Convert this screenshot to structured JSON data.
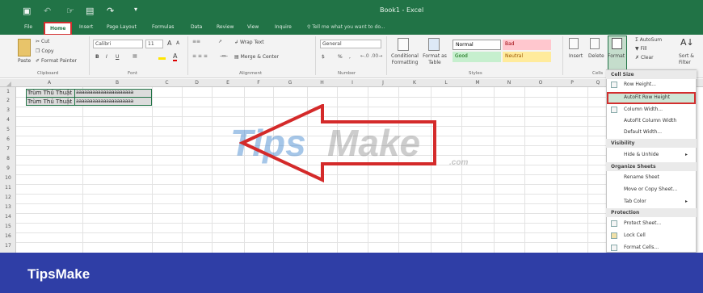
{
  "window": {
    "title": "Book1 - Excel"
  },
  "titlebar_icons": [
    "save-icon",
    "undo-icon",
    "touch-icon",
    "table-icon",
    "redo-icon",
    "customize-icon"
  ],
  "tabs": [
    "File",
    "Home",
    "Insert",
    "Page Layout",
    "Formulas",
    "Data",
    "Review",
    "View",
    "Inquire"
  ],
  "tellme": "Tell me what you want to do...",
  "ribbon": {
    "clipboard": {
      "paste": "Paste",
      "cut": "Cut",
      "copy": "Copy",
      "format_painter": "Format Painter",
      "group": "Clipboard"
    },
    "font": {
      "name": "Calibri",
      "size": "11",
      "bold": "B",
      "italic": "I",
      "underline": "U",
      "grow": "A",
      "shrink": "A",
      "group": "Font"
    },
    "alignment": {
      "wrap": "Wrap Text",
      "merge": "Merge & Center",
      "group": "Alignment"
    },
    "number": {
      "format": "General",
      "currency": "$",
      "percent": "%",
      "comma": ",",
      "group": "Number"
    },
    "styles": {
      "conditional": "Conditional Formatting",
      "format_as_table": "Format as Table",
      "normal": "Normal",
      "bad": "Bad",
      "good": "Good",
      "neutral": "Neutral",
      "group": "Styles"
    },
    "cells": {
      "insert": "Insert",
      "delete": "Delete",
      "format": "Format",
      "group": "Cells"
    },
    "editing": {
      "autosum": "AutoSum",
      "fill": "Fill",
      "clear": "Clear",
      "sort": "Sort & Filter"
    },
    "colors": {
      "bad_bg": "#ffc7ce",
      "good_bg": "#c6efce",
      "neutral_bg": "#ffeb9c",
      "brand_green": "#217346"
    }
  },
  "columns": [
    "A",
    "B",
    "C",
    "D",
    "E",
    "F",
    "G",
    "H",
    "I",
    "J",
    "K",
    "L",
    "M",
    "N",
    "O",
    "P",
    "Q"
  ],
  "rows": [
    "1",
    "2",
    "3",
    "4",
    "5",
    "6",
    "7",
    "8",
    "9",
    "10",
    "11",
    "12",
    "13",
    "14",
    "15",
    "16",
    "17"
  ],
  "cells": {
    "a1": "Trùm Thủ Thuật",
    "b1": "aaaaaaaaaaaaaaaaaaaaa",
    "a2": "Trùm Thủ Thuật",
    "b2": "aaaaaaaaaaaaaaaaaaaaa"
  },
  "format_menu": {
    "cell_size": "Cell Size",
    "row_height": "Row Height...",
    "autofit_row": "AutoFit Row Height",
    "col_width": "Column Width...",
    "autofit_col": "AutoFit Column Width",
    "default_width": "Default Width...",
    "visibility": "Visibility",
    "hide_unhide": "Hide & Unhide",
    "organize": "Organize Sheets",
    "rename": "Rename Sheet",
    "move_copy": "Move or Copy Sheet...",
    "tab_color": "Tab Color",
    "protection": "Protection",
    "protect_sheet": "Protect Sheet...",
    "lock_cell": "Lock Cell",
    "format_cells": "Format Cells..."
  },
  "watermark": {
    "tips": "Tips",
    "make": "Make",
    "com": ".com"
  },
  "footer": {
    "brand": "TipsMake"
  }
}
